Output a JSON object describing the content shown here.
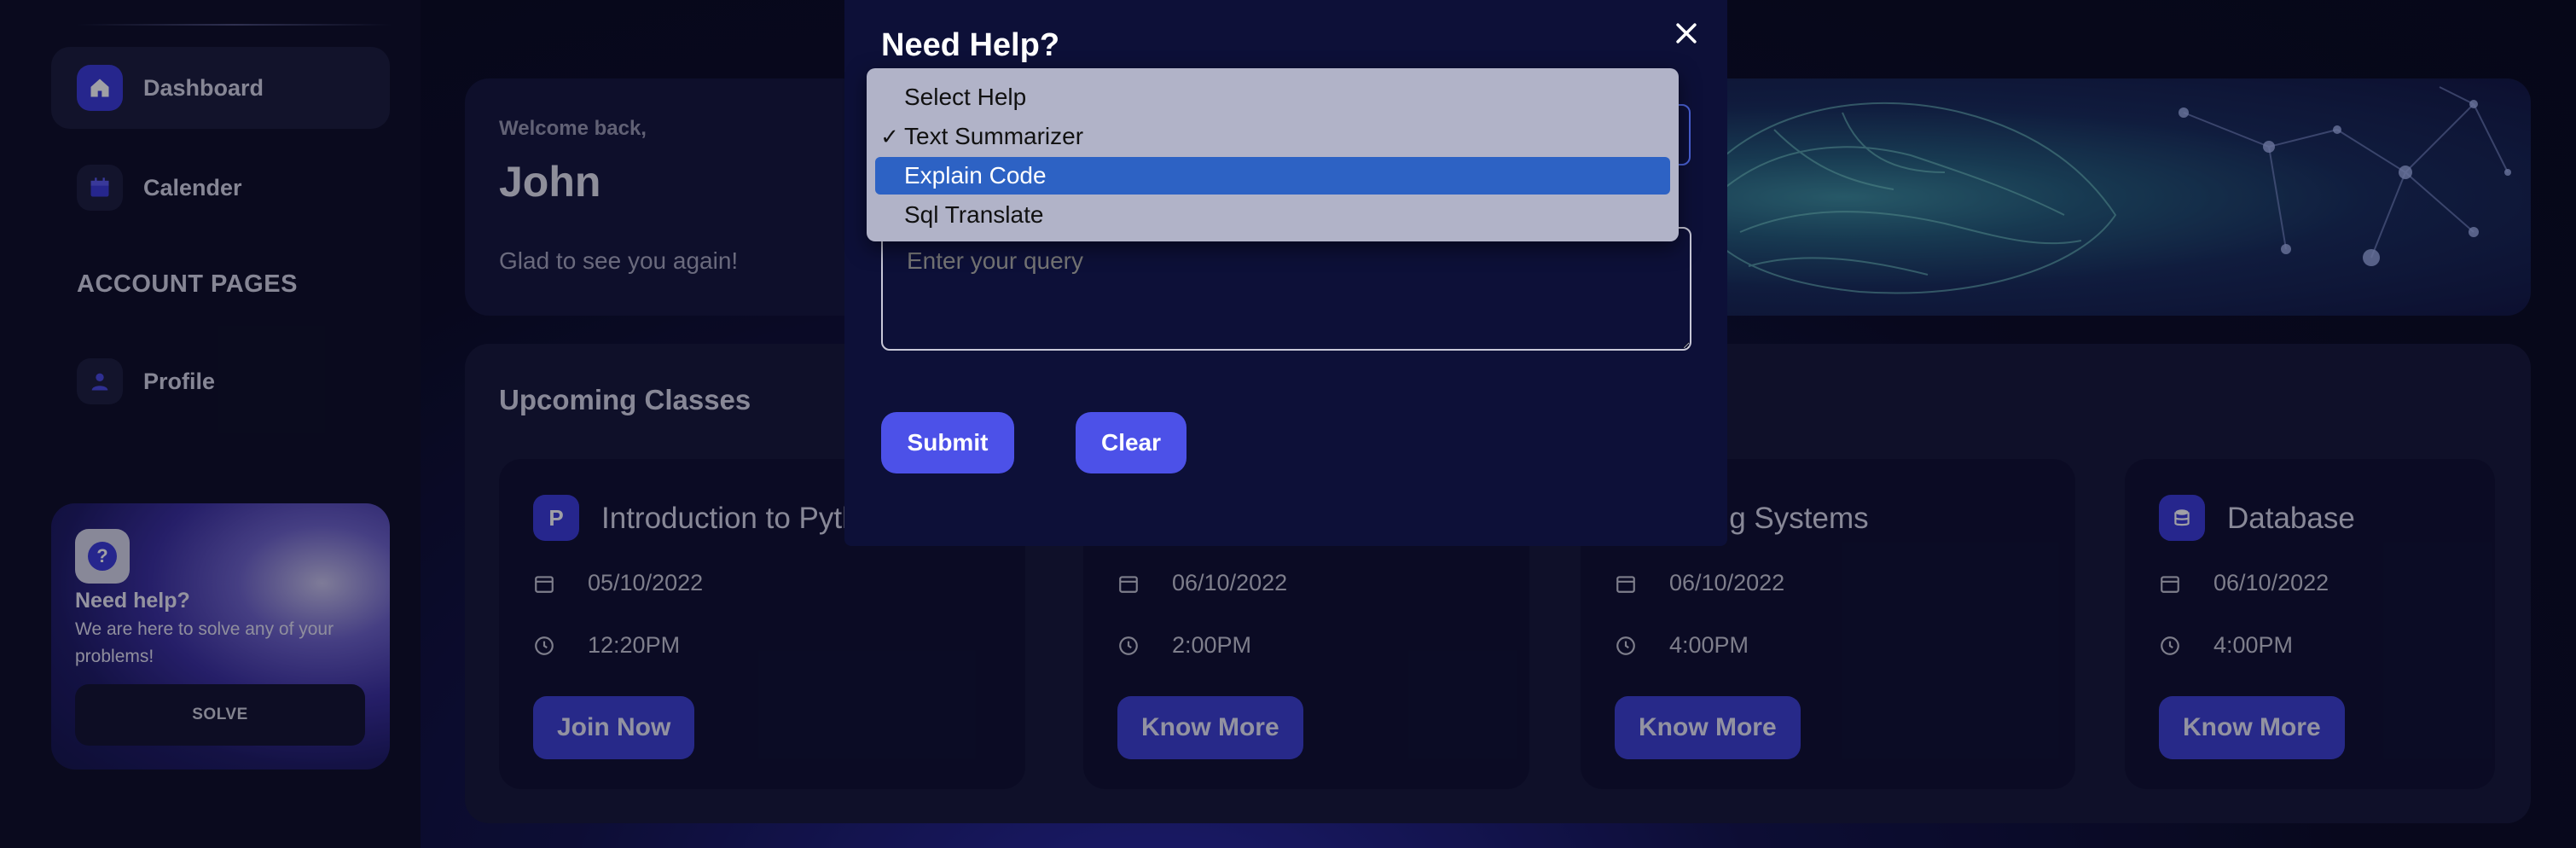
{
  "sidebar": {
    "items": [
      {
        "label": "Dashboard",
        "icon": "home-icon",
        "active": true
      },
      {
        "label": "Calender",
        "icon": "calendar-icon",
        "active": false
      },
      {
        "label": "Profile",
        "icon": "person-icon",
        "active": false
      }
    ],
    "section_title": "ACCOUNT PAGES",
    "help_card": {
      "icon": "question-icon",
      "title": "Need help?",
      "text": "We are here to solve any of your problems!",
      "button": "SOLVE"
    }
  },
  "welcome": {
    "greeting": "Welcome back,",
    "name": "John",
    "message": "Glad to see you again!"
  },
  "classes": {
    "title": "Upcoming Classes",
    "items": [
      {
        "icon_text": "P",
        "name": "Introduction to Python",
        "date": "05/10/2022",
        "time": "12:20PM",
        "button": "Join Now"
      },
      {
        "icon_text": "",
        "name": "",
        "date": "06/10/2022",
        "time": "2:00PM",
        "button": "Know More"
      },
      {
        "icon_text": "",
        "name": "Operating Systems",
        "date": "06/10/2022",
        "time": "4:00PM",
        "button": "Know More"
      },
      {
        "icon_text": "",
        "name": "Database",
        "date": "06/10/2022",
        "time": "4:00PM",
        "button": "Know More"
      }
    ]
  },
  "modal": {
    "title": "Need Help?",
    "close_icon": "close-icon",
    "select": {
      "selected": "Text Summarizer",
      "highlighted": "Explain Code",
      "options": [
        "Select Help",
        "Text Summarizer",
        "Explain Code",
        "Sql Translate"
      ]
    },
    "query_placeholder": "Enter your query",
    "submit_label": "Submit",
    "clear_label": "Clear"
  },
  "colors": {
    "accent": "#4c51e8",
    "modal_bg": "#0d1038",
    "dropdown_bg": "#b1b3c8",
    "dropdown_highlight": "#2d62c4"
  }
}
